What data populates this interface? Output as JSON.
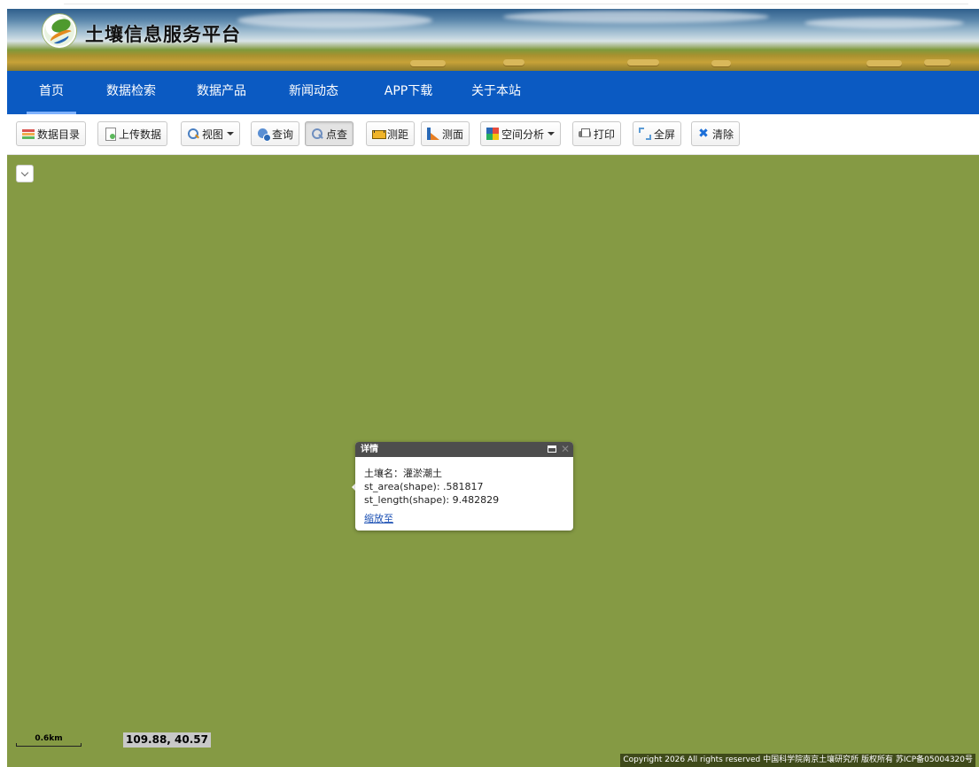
{
  "header": {
    "site_title": "土壤信息服务平台"
  },
  "nav": {
    "items": [
      {
        "label": "首页",
        "active": true
      },
      {
        "label": "数据检索",
        "active": false
      },
      {
        "label": "数据产品",
        "active": false
      },
      {
        "label": "新闻动态",
        "active": false
      },
      {
        "label": "APP下载",
        "active": false
      },
      {
        "label": "关于本站",
        "active": false
      }
    ]
  },
  "toolbar": {
    "catalog": "数据目录",
    "upload": "上传数据",
    "view": "视图",
    "query": "查询",
    "point_query": "点查",
    "measure_distance": "测距",
    "measure_area": "测面",
    "spatial_analysis": "空间分析",
    "print": "打印",
    "fullscreen": "全屏",
    "clear": "清除",
    "pressed": "点查"
  },
  "map": {
    "background_color": "#859a44",
    "scale_label": "0.6km",
    "coordinates": "109.88, 40.57",
    "copyright": "Copyright 2026 All rights reserved 中国科学院南京土壤研究所 版权所有 苏ICP备05004320号"
  },
  "popup": {
    "title": "详情",
    "soil_name_line": "土壤名：灌淤潮土",
    "area_line": "st_area(shape): .581817",
    "length_line": "st_length(shape): 9.482829",
    "zoom_link": "缩放至",
    "close_glyph": "✕"
  },
  "colors": {
    "nav_background": "#0b5ac2",
    "popup_header": "#4d4d4d",
    "link": "#1a4fb3"
  }
}
